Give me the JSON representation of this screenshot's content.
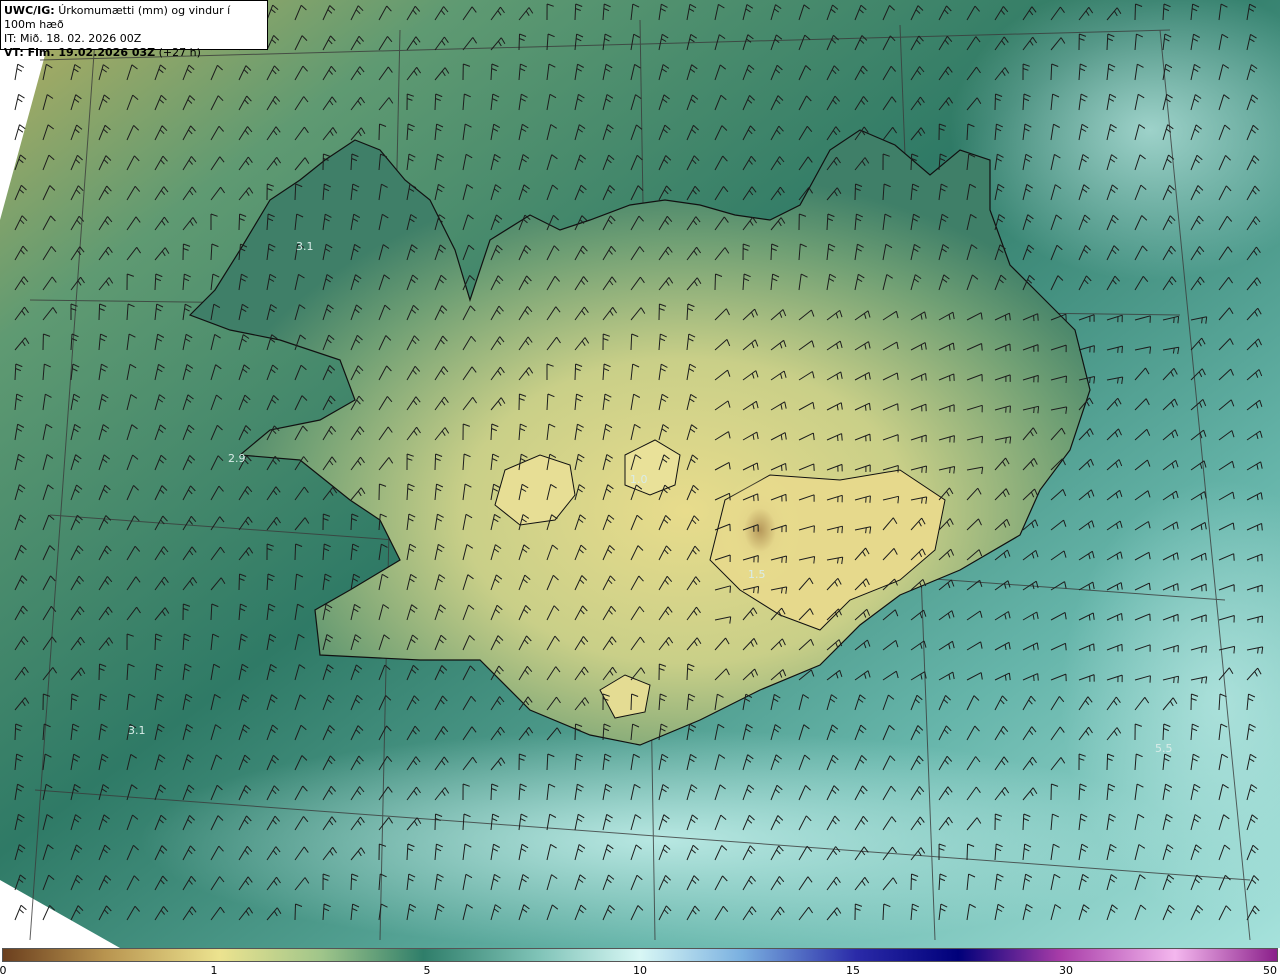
{
  "header": {
    "product": "UWC/IG:",
    "title": "Úrkomumætti (mm) og vindur í 100m hæð",
    "it_label": "IT:",
    "it_value": "Mið. 18. 02. 2026 00Z",
    "vt_label": "VT: Fim. 19.02.2026 03Z",
    "vt_offset": "(+27 h)"
  },
  "value_labels": [
    {
      "text": "3.1",
      "name": "value-label-westfjords"
    },
    {
      "text": "2.9",
      "name": "value-label-snaefellsnes"
    },
    {
      "text": "1.0",
      "name": "value-label-hofsjokull"
    },
    {
      "text": "1.5",
      "name": "value-label-vatnajokull"
    },
    {
      "text": "3.1",
      "name": "value-label-southwest-sea"
    },
    {
      "text": "5.5",
      "name": "value-label-southeast-sea"
    }
  ],
  "colorbar": {
    "ticks": [
      {
        "label": "0",
        "value": 0
      },
      {
        "label": "1",
        "value": 1
      },
      {
        "label": "5",
        "value": 5
      },
      {
        "label": "10",
        "value": 10
      },
      {
        "label": "15",
        "value": 15
      },
      {
        "label": "30",
        "value": 30
      },
      {
        "label": "50",
        "value": 50
      }
    ],
    "colors": [
      "#6b3f1e",
      "#b8944f",
      "#ece38f",
      "#9fc58a",
      "#2f7e6a",
      "#7fc3b7",
      "#d8f7f5",
      "#7ab0e0",
      "#2a2aa8",
      "#00007a",
      "#a83ca8",
      "#f4b7ee",
      "#8a1f8a"
    ]
  },
  "colors": {
    "land_dry": "#e9df92",
    "land_mid": "#a6c48a",
    "sea_deep": "#2e7464",
    "sea_light": "#a9e3dd",
    "coast": "#111111"
  }
}
